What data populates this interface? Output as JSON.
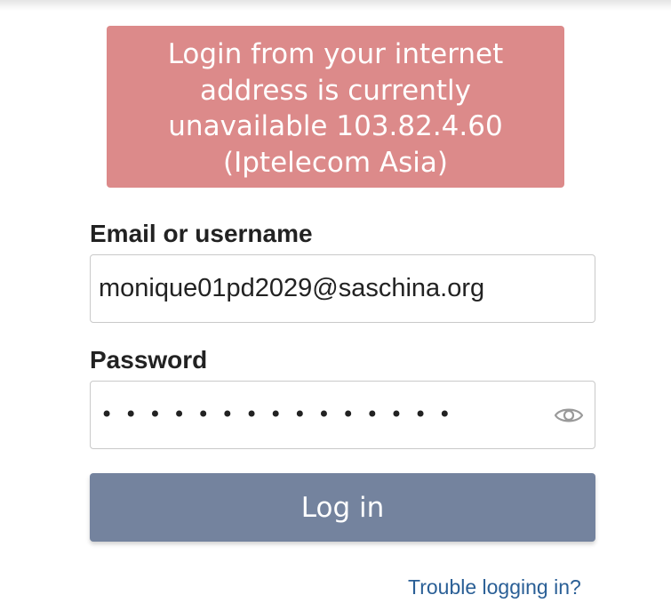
{
  "alert": {
    "message": "Login from your internet address is currently unavailable 103.82.4.60 (Iptelecom Asia)",
    "background_color": "#dc8a8a"
  },
  "form": {
    "email_label": "Email or username",
    "email_value": "monique01pd2029@saschina.org",
    "password_label": "Password",
    "password_masked": "•••••••••••••••",
    "show_password_icon": "eye-icon",
    "login_button_label": "Log in",
    "login_button_color": "#74839e",
    "trouble_link_label": "Trouble logging in?",
    "link_color": "#2a5f96"
  }
}
